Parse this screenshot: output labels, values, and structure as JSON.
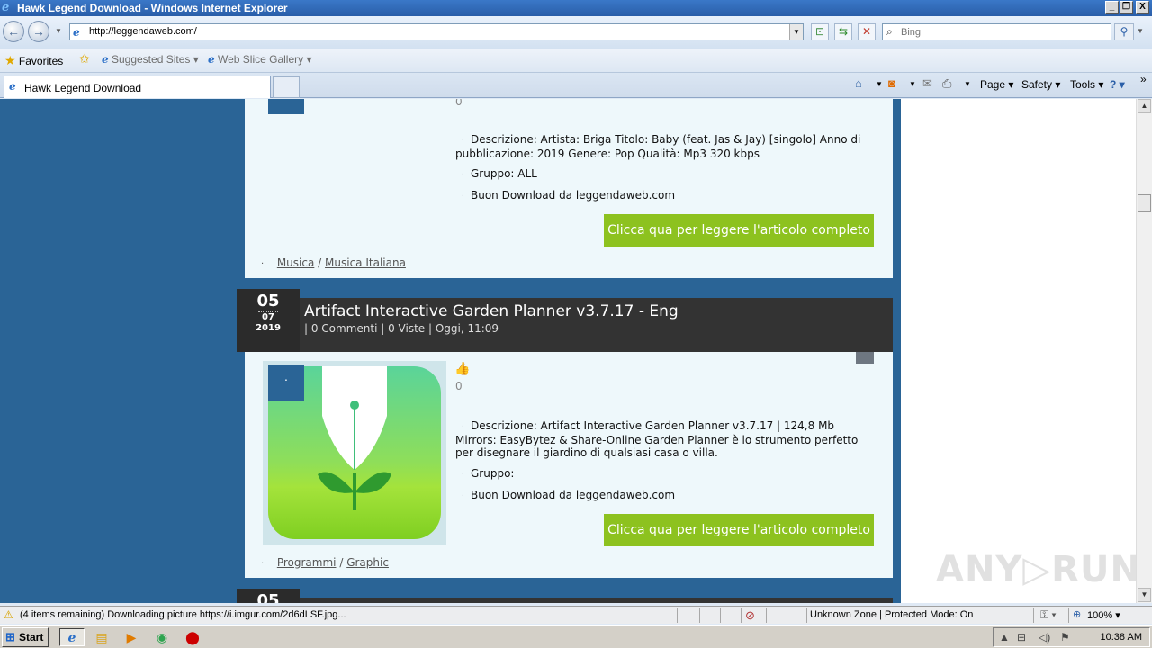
{
  "window": {
    "title": "Hawk Legend Download - Windows Internet Explorer",
    "btn_min": "_",
    "btn_restore": "❐",
    "btn_close": "X"
  },
  "nav": {
    "back_glyph": "←",
    "forward_glyph": "→",
    "url": "http://leggendaweb.com/",
    "search_placeholder": "Bing"
  },
  "favorites_bar": {
    "favorites_label": "Favorites",
    "suggested_label": "Suggested Sites ▾",
    "webslice_label": "Web Slice Gallery ▾"
  },
  "tabs": [
    {
      "label": "Hawk Legend Download"
    }
  ],
  "command_bar": {
    "page": "Page ▾",
    "safety": "Safety ▾",
    "tools": "Tools ▾",
    "help": "? ▾"
  },
  "post1": {
    "rating_count": "0",
    "description": "Descrizione: Artista: Briga Titolo: Baby (feat. Jas & Jay) [singolo] Anno di pubblicazione: 2019 Genere: Pop Qualità: Mp3 320 kbps",
    "group": "Gruppo: ALL",
    "download": "Buon Download da leggendaweb.com",
    "read_more": "Clicca qua per leggere l'articolo completo",
    "cat1": "Musica",
    "cat_sep": "/",
    "cat2": "Musica Italiana"
  },
  "post2": {
    "day": "05",
    "month": "07",
    "year": "2019",
    "title": "Artifact Interactive Garden Planner v3.7.17 - Eng",
    "meta": "| 0 Commenti | 0 Viste | Oggi, 11:09",
    "rating_count": "0",
    "description": "Descrizione: Artifact Interactive Garden Planner v3.7.17 | 124,8 Mb Mirrors: EasyBytez & Share-Online Garden Planner è lo strumento perfetto per disegnare il giardino di qualsiasi casa o villa.",
    "group": "Gruppo:",
    "download": "Buon Download da leggendaweb.com",
    "read_more": "Clicca qua per leggere l'articolo completo",
    "cat1": "Programmi",
    "cat_sep": "/",
    "cat2": "Graphic"
  },
  "post3": {
    "day": "05"
  },
  "status": {
    "message": "(4 items remaining) Downloading picture https://i.imgur.com/2d6dLSF.jpg...",
    "zone": "Unknown Zone | Protected Mode: On",
    "zoom": "100% ▾"
  },
  "taskbar": {
    "start": "Start",
    "time": "10:38 AM"
  },
  "watermark": "ANY▷RUN"
}
